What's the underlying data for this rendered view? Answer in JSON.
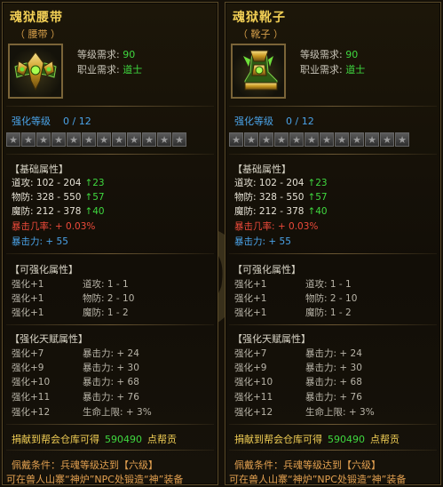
{
  "items": [
    {
      "name": "魂狱腰带",
      "type": "（ 腰带 ）",
      "req_level_label": "等级需求: ",
      "req_level_value": "90",
      "req_job_label": "职业需求: ",
      "req_job_value": "道士",
      "enhance_label": "强化等级",
      "enhance_count": "0 / 12",
      "stars_total": 12,
      "base_head": "【基础属性】",
      "base": [
        {
          "label": "道攻: ",
          "value": "102 - 204",
          "bonus": "23"
        },
        {
          "label": "物防: ",
          "value": "328 - 550",
          "bonus": "57"
        },
        {
          "label": "魔防: ",
          "value": "212 - 378",
          "bonus": "40"
        }
      ],
      "crit_rate": "暴击几率: + 0.03%",
      "crit_power": "暴击力: + 55",
      "enh_head": "【可强化属性】",
      "enh": [
        {
          "lv": "强化+1",
          "attr": "道攻: 1 - 1"
        },
        {
          "lv": "强化+1",
          "attr": "物防: 2 - 10"
        },
        {
          "lv": "强化+1",
          "attr": "魔防: 1 - 2"
        }
      ],
      "talent_head": "【强化天赋属性】",
      "talent": [
        {
          "lv": "强化+7",
          "attr": "暴击力: + 24"
        },
        {
          "lv": "强化+9",
          "attr": "暴击力: + 30"
        },
        {
          "lv": "强化+10",
          "attr": "暴击力: + 68"
        },
        {
          "lv": "强化+11",
          "attr": "暴击力: + 76"
        },
        {
          "lv": "强化+12",
          "attr": "生命上限: + 3%"
        }
      ],
      "contrib_pre": "捐献到帮会仓库可得",
      "contrib_num": "590490",
      "contrib_post": "点帮贡",
      "equip_cond": "佩戴条件：兵魂等级达到【六级】",
      "forge": "可在兽人山寨“神炉”NPC处锻造“神”装备"
    },
    {
      "name": "魂狱靴子",
      "type": "（ 靴子 ）",
      "req_level_label": "等级需求: ",
      "req_level_value": "90",
      "req_job_label": "职业需求: ",
      "req_job_value": "道士",
      "enhance_label": "强化等级",
      "enhance_count": "0 / 12",
      "stars_total": 12,
      "base_head": "【基础属性】",
      "base": [
        {
          "label": "道攻: ",
          "value": "102 - 204",
          "bonus": "23"
        },
        {
          "label": "物防: ",
          "value": "328 - 550",
          "bonus": "57"
        },
        {
          "label": "魔防: ",
          "value": "212 - 378",
          "bonus": "40"
        }
      ],
      "crit_rate": "暴击几率: + 0.03%",
      "crit_power": "暴击力: + 55",
      "enh_head": "【可强化属性】",
      "enh": [
        {
          "lv": "强化+1",
          "attr": "道攻: 1 - 1"
        },
        {
          "lv": "强化+1",
          "attr": "物防: 2 - 10"
        },
        {
          "lv": "强化+1",
          "attr": "魔防: 1 - 2"
        }
      ],
      "talent_head": "【强化天赋属性】",
      "talent": [
        {
          "lv": "强化+7",
          "attr": "暴击力: + 24"
        },
        {
          "lv": "强化+9",
          "attr": "暴击力: + 30"
        },
        {
          "lv": "强化+10",
          "attr": "暴击力: + 68"
        },
        {
          "lv": "强化+11",
          "attr": "暴击力: + 76"
        },
        {
          "lv": "强化+12",
          "attr": "生命上限: + 3%"
        }
      ],
      "contrib_pre": "捐献到帮会仓库可得",
      "contrib_num": "590490",
      "contrib_post": "点帮贡",
      "equip_cond": "佩戴条件：兵魂等级达到【六级】",
      "forge": "可在兽人山寨“神炉”NPC处锻造“神”装备"
    }
  ],
  "icons": [
    "belt-item-icon",
    "boots-item-icon",
    "star-icon",
    "up-arrow-icon"
  ],
  "colors": {
    "title": "#f2cf55",
    "green": "#3fd83f",
    "blue": "#4aa3e8",
    "red": "#ee4a3a",
    "orange": "#e2a050"
  }
}
